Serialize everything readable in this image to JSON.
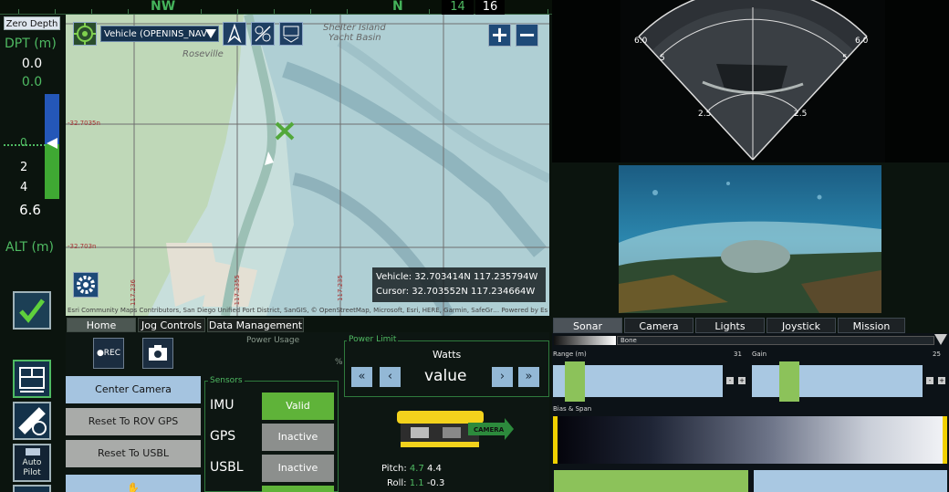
{
  "heading": {
    "label_nw": "NW",
    "label_n": "N",
    "readout_left": "14",
    "readout_right": "16"
  },
  "depth_panel": {
    "zero_depth_button": "Zero Depth",
    "dpt_label": "DPT (m)",
    "dpt_value_1": "0.0",
    "dpt_value_2": "0.0",
    "scale_0": "0",
    "scale_2": "2",
    "scale_4": "4",
    "depth_reading": "6.6",
    "alt_label": "ALT (m)",
    "autopilot_label": "Auto Pilot"
  },
  "map": {
    "vehicle_select": "Vehicle (OPENINS_NAV",
    "place_roseville": "Roseville",
    "place_shelter_1": "Shelter Island",
    "place_shelter_2": "Yacht Basin",
    "lat_1": "-32.7035n",
    "lat_2": "-32.703n",
    "lon_1": "117.236",
    "lon_2": "117.2355",
    "lon_3": "117.235",
    "vehicle_coord": "Vehicle: 32.703414N 117.235794W",
    "cursor_coord": "Cursor: 32.703552N 117.234664W",
    "attribution": "Esri Community Maps Contributors, San Diego Unified Port District, SanGIS, © OpenStreetMap, Microsoft, Esri, HERE, Garmin, SafeGr…   Powered by Esri"
  },
  "sonar": {
    "range_6_left": "6.0",
    "range_6_right": "6.0",
    "range_5_left": "5",
    "range_5_right": "5",
    "range_25_left": "2.5",
    "range_25_right": "2.5"
  },
  "left_tabs": [
    "Home",
    "Jog Controls",
    "Data Management"
  ],
  "controls": {
    "power_usage_label": "Power Usage",
    "percent_label": "%",
    "rec_label": "●REC",
    "center_camera": "Center Camera",
    "reset_rov_gps": "Reset To ROV GPS",
    "reset_usbl": "Reset To USBL"
  },
  "sensors": {
    "title": "Sensors",
    "items": [
      {
        "name": "IMU",
        "status": "Valid"
      },
      {
        "name": "GPS",
        "status": "Inactive"
      },
      {
        "name": "USBL",
        "status": "Inactive"
      }
    ]
  },
  "power_limit": {
    "title": "Power Limit",
    "watts_label": "Watts",
    "value_label": "value",
    "btn_ff_back": "«",
    "btn_back": "‹",
    "btn_fwd": "›",
    "btn_ff_fwd": "»"
  },
  "attitude": {
    "camera_tag": "CAMERA",
    "pitch_label": "Pitch:",
    "pitch_a": "4.7",
    "pitch_b": "4.4",
    "roll_label": "Roll:",
    "roll_a": "1.1",
    "roll_b": "-0.3"
  },
  "right_tabs": [
    "Sonar",
    "Camera",
    "Lights",
    "Joystick Gains",
    "Mission"
  ],
  "sonar_settings": {
    "palette_label": "Bone",
    "range_label": "Range (m)",
    "range_max": "31",
    "range_level": 0.13,
    "gain_label": "Gain",
    "gain_max": "25",
    "gain_level": 0.22,
    "bias_span_label": "Bias & Span",
    "minus": "-",
    "plus": "+"
  },
  "colors": {
    "green_accent": "#4fba62",
    "valid_green": "#5fb339",
    "inactive_gray": "#8c8f8d"
  }
}
